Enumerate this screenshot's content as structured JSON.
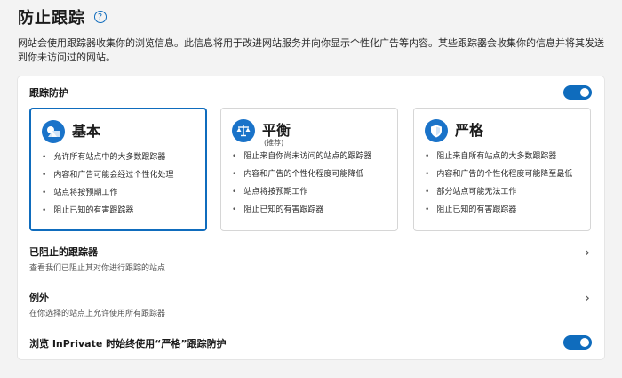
{
  "header": {
    "title": "防止跟踪",
    "help_icon": "help-circle-icon",
    "description": "网站会使用跟踪器收集你的浏览信息。此信息将用于改进网站服务并向你显示个性化广告等内容。某些跟踪器会收集你的信息并将其发送到你未访问过的网站。"
  },
  "tracking_prevention": {
    "label": "跟踪防护",
    "toggle_on": true
  },
  "levels": [
    {
      "title": "基本",
      "subtitle": "",
      "icon": "shapes-icon",
      "selected": true,
      "bullets": [
        "允许所有站点中的大多数跟踪器",
        "内容和广告可能会经过个性化处理",
        "站点将按预期工作",
        "阻止已知的有害跟踪器"
      ]
    },
    {
      "title": "平衡",
      "subtitle": "(推荐)",
      "icon": "scale-icon",
      "selected": false,
      "bullets": [
        "阻止来自你尚未访问的站点的跟踪器",
        "内容和广告的个性化程度可能降低",
        "站点将按预期工作",
        "阻止已知的有害跟踪器"
      ]
    },
    {
      "title": "严格",
      "subtitle": "",
      "icon": "shield-icon",
      "selected": false,
      "bullets": [
        "阻止来自所有站点的大多数跟踪器",
        "内容和广告的个性化程度可能降至最低",
        "部分站点可能无法工作",
        "阻止已知的有害跟踪器"
      ]
    }
  ],
  "blocked_trackers": {
    "title": "已阻止的跟踪器",
    "subtitle": "查看我们已阻止其对你进行跟踪的站点"
  },
  "exceptions": {
    "title": "例外",
    "subtitle": "在你选择的站点上允许使用所有跟踪器"
  },
  "inprivate": {
    "label": "浏览 InPrivate 时始终使用“严格”跟踪防护",
    "toggle_on": true
  },
  "colors": {
    "accent": "#0f6cbd",
    "background": "#f3f3f3",
    "panel": "#ffffff"
  }
}
